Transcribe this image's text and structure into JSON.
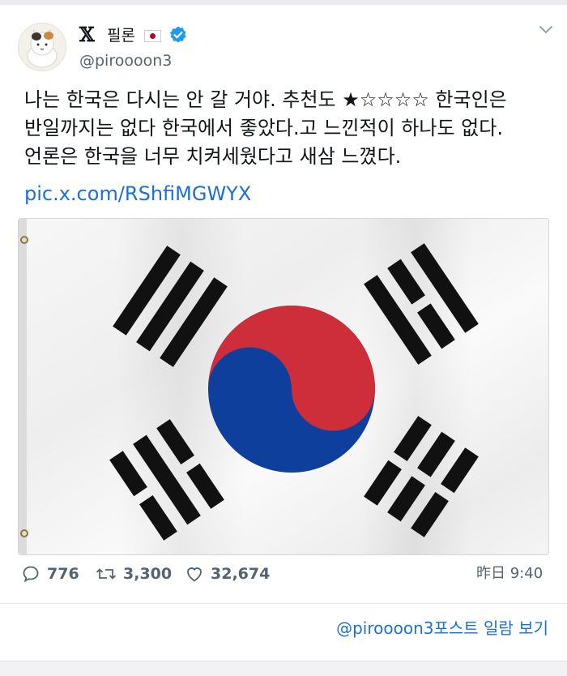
{
  "app": {
    "logo_text": "𝕏"
  },
  "author": {
    "display_name": "필론",
    "flag_icon": "japan-flag-icon",
    "verified": true,
    "handle": "@piroooon3",
    "avatar_icon": "cat-avatar-icon"
  },
  "tweet": {
    "lines": [
      "나는 한국은 다시는 안 갈 거야. 추천도 ★☆☆☆☆ 한국인은",
      "반일까지는 없다 한국에서 좋았다.고 느낀적이 하나도 없다.",
      "언론은 한국을 너무 치켜세웠다고 새삼 느꼈다."
    ],
    "link": "pic.x.com/RShfiMGWYX",
    "media_icon": "south-korea-flag-image"
  },
  "metrics": {
    "replies": "776",
    "reposts": "3,300",
    "likes": "32,674",
    "timestamp": "昨日 9:40"
  },
  "footer": {
    "view_posts": "@piroooon3포스트 일람 보기"
  },
  "colors": {
    "link": "#1d6fd8",
    "verified": "#1d9bf0",
    "muted": "#536471",
    "taeguk_red": "#cd2e3a",
    "taeguk_blue": "#0f3f9c"
  }
}
